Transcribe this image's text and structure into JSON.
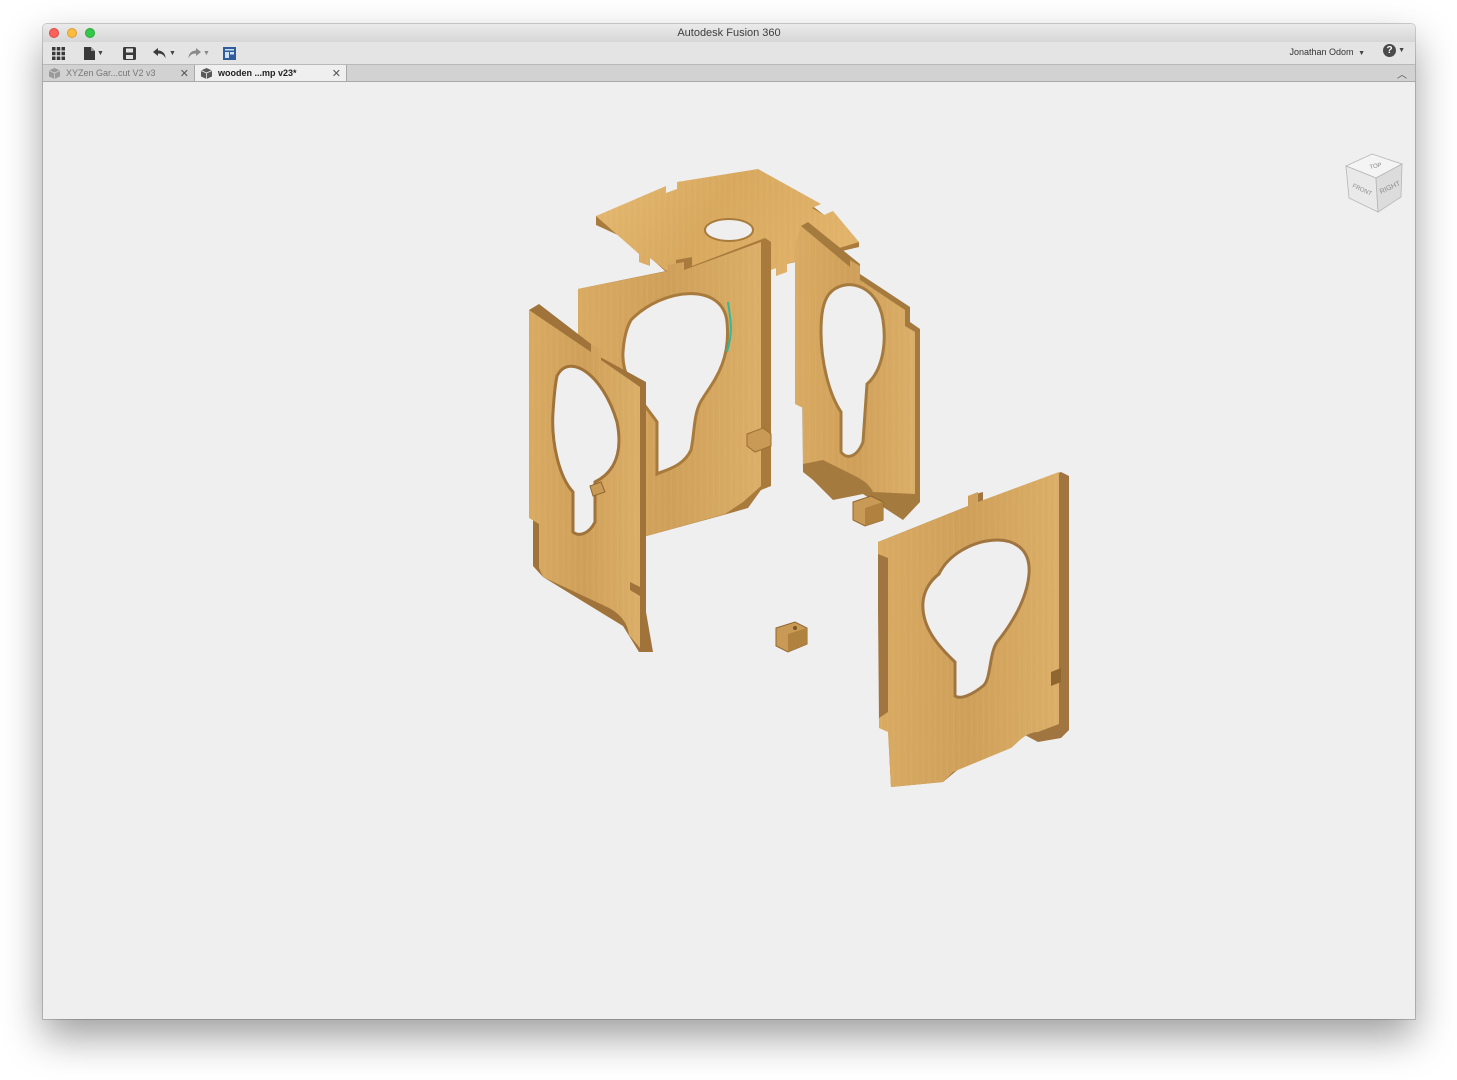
{
  "window": {
    "title": "Autodesk Fusion 360"
  },
  "toolbar": {
    "icons": [
      "grid-icon",
      "file-icon",
      "save-icon",
      "undo-icon",
      "redo-icon",
      "job-status-icon"
    ],
    "user_name": "Jonathan Odom",
    "help_label": "?"
  },
  "tabs": [
    {
      "label": "XYZen Gar...cut V2 v3",
      "active": false,
      "icon": "box-icon"
    },
    {
      "label": "wooden ...mp v23*",
      "active": true,
      "icon": "box-icon"
    }
  ],
  "viewcube": {
    "faces": [
      "TOP",
      "FRONT",
      "RIGHT"
    ]
  },
  "colors": {
    "wood_light": "#e3b46c",
    "wood_mid": "#d0a35e",
    "wood_dark": "#a87b3e",
    "wood_edge": "#8f6530",
    "viewport_bg": "#efefef",
    "accent": "#2f5c9a"
  }
}
